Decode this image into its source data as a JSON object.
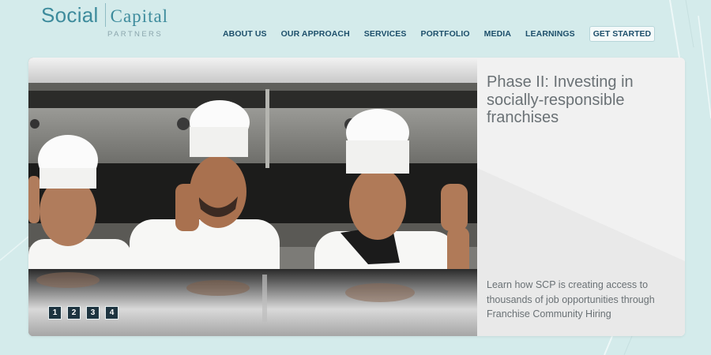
{
  "logo": {
    "word1": "Social",
    "word2": "Capital",
    "sub": "PARTNERS"
  },
  "nav": {
    "items": [
      "ABOUT US",
      "OUR APPROACH",
      "SERVICES",
      "PORTFOLIO",
      "MEDIA",
      "LEARNINGS"
    ],
    "cta": "GET STARTED"
  },
  "hero": {
    "title": "Phase II: Investing in socially-responsible franchises",
    "description": "Learn how SCP is creating access to thousands of job opportunities through Franchise Community Hiring",
    "pager": [
      "1",
      "2",
      "3",
      "4"
    ]
  }
}
